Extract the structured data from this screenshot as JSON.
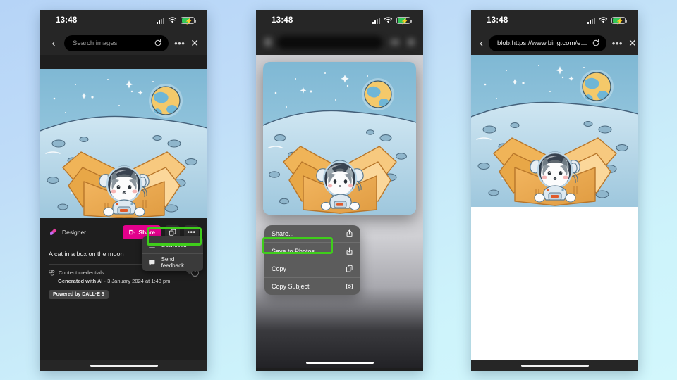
{
  "background": {
    "color_top": "#b6d4f7",
    "color_bottom": "#d2f7fc"
  },
  "accents": {
    "highlight_green": "#3fcd1b",
    "share_pink": "#e3008c",
    "battery_green": "#33c759"
  },
  "status_bar": {
    "time": "13:48",
    "cellular_icon": "cellular-signal-icon",
    "wifi_icon": "wifi-icon",
    "battery_icon": "battery-charging-icon"
  },
  "phone1": {
    "toolbar": {
      "back_icon": "chevron-left-icon",
      "search_placeholder": "Search images",
      "reload_icon": "reload-icon",
      "more_icon": "more-dots-icon",
      "close_icon": "close-x-icon"
    },
    "artwork": {
      "alt": "A cat wearing an astronaut suit sitting inside a cardboard box on the moon with Earth in the sky"
    },
    "popover": {
      "items": [
        {
          "label": "Download",
          "icon": "download-icon"
        },
        {
          "label": "Send feedback",
          "icon": "feedback-bubble-icon"
        }
      ],
      "highlighted": "Download"
    },
    "actions": {
      "app_icon": "designer-brush-icon",
      "app_label": "Designer",
      "share_label": "Share",
      "share_icon": "share-arrow-icon",
      "variants_icon": "copy-layers-icon",
      "more_icon": "more-dots-icon"
    },
    "caption": "A cat in a box on the moon",
    "credentials": {
      "icon": "content-credentials-icon",
      "title": "Content credentials",
      "detail": "Generated with AI",
      "detail_meta": " · 3 January 2024 at 1:48 pm",
      "help_icon": "help-question-icon",
      "badge": "Powered by DALL·E 3"
    }
  },
  "phone2": {
    "toolbar_state": "blurred",
    "context_menu": {
      "items": [
        {
          "label": "Share...",
          "icon": "share-box-icon"
        },
        {
          "label": "Save to Photos",
          "icon": "save-download-icon"
        },
        {
          "label": "Copy",
          "icon": "copy-pages-icon"
        },
        {
          "label": "Copy Subject",
          "icon": "copy-subject-icon"
        }
      ],
      "highlighted": "Save to Photos"
    }
  },
  "phone3": {
    "toolbar": {
      "back_icon": "chevron-left-icon",
      "url_value": "blob:https://www.bing.com/e…",
      "reload_icon": "reload-icon",
      "more_icon": "more-dots-icon",
      "close_icon": "close-x-icon"
    }
  }
}
